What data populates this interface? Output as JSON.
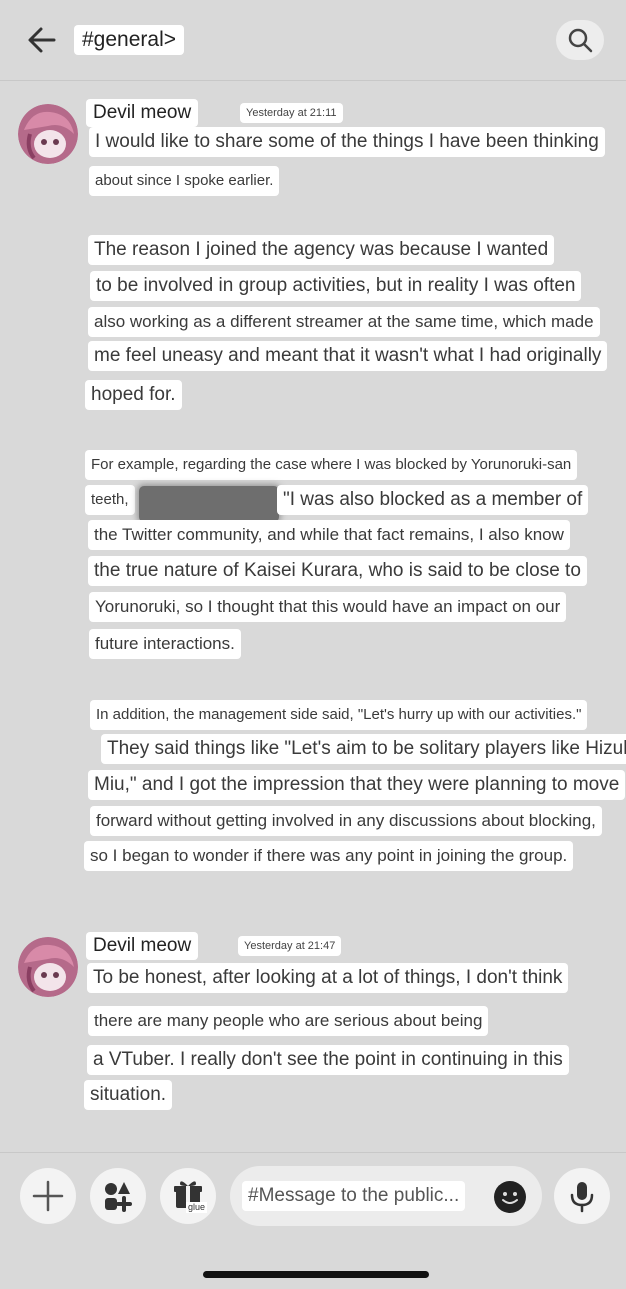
{
  "header": {
    "channel": "#general>",
    "back_icon": "arrow-left-icon",
    "search_icon": "search-icon"
  },
  "messages": [
    {
      "username": "Devil meow",
      "timestamp": "Yesterday at 21:11",
      "lines": [
        "I would like to share some of the things I have been thinking",
        "about since I spoke earlier.",
        "The reason I joined the agency was because I wanted",
        "to be involved in group activities, but in reality I was often",
        "also working as a different streamer at the same time, which made",
        "me feel uneasy and meant that it wasn't what I had originally",
        "hoped for.",
        "For example, regarding the case where I was blocked by Yorunoruki-san",
        "teeth,",
        "\"I was also blocked as a member of",
        "the Twitter community, and while that fact remains, I also know",
        "the true nature of Kaisei Kurara, who is said to be close to",
        "Yorunoruki, so I thought that this would have an impact on our",
        "future interactions.",
        "In addition, the management side said, \"Let's hurry up with our activities.\"",
        "They said things like \"Let's aim to be solitary players like Hizuki",
        "Miu,\" and I got the impression that they were planning to move",
        "forward without getting involved in any discussions about blocking,",
        "so I began to wonder if there was any point in joining the group."
      ]
    },
    {
      "username": "Devil meow",
      "timestamp": "Yesterday at 21:47",
      "lines": [
        "To be honest, after looking at a lot of things, I don't think",
        "there are many people who are serious about being",
        "a VTuber. I really don't see the point in continuing in this",
        "situation."
      ]
    }
  ],
  "composer": {
    "placeholder": "#Message to the public...",
    "gift_tag": "glue",
    "icons": [
      "plus-icon",
      "apps-icon",
      "gift-icon",
      "emoji-icon",
      "microphone-icon"
    ]
  }
}
